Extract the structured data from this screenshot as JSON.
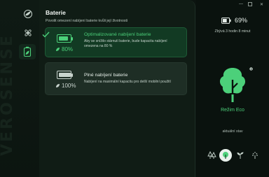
{
  "app": {
    "brand": "VEROSENSE"
  },
  "sidebar": {
    "items": [
      {
        "icon": "leaf-globe-icon",
        "label": ""
      },
      {
        "icon": "fan-icon",
        "label": ""
      },
      {
        "icon": "battery-leaf-icon",
        "label": ""
      }
    ]
  },
  "battery_settings": {
    "title": "Baterie",
    "description": "Povolit omezení nabíjení baterie kvůli její životnosti",
    "options": [
      {
        "id": "optimized",
        "title": "Optimalizované nabíjení baterie",
        "text": "Aby se snížilo stárnutí baterie, bude kapacita nabíjení omezena na 80 %",
        "percent_label": "80%",
        "fill_fraction": 0.8,
        "selected": true
      },
      {
        "id": "full",
        "title": "Plné nabíjení baterie",
        "text": "Nabíjení na maximální kapacitu pro delší mobilní použití",
        "percent_label": "100%",
        "fill_fraction": 1.0,
        "selected": false
      }
    ]
  },
  "status": {
    "battery_percent": "69%",
    "battery_fraction": 0.69,
    "remaining": "Zbývá 3 hodin 8 minut",
    "mode_name": "Režim Eco",
    "current_state_label": "aktuální stav",
    "modes": [
      {
        "icon": "trees-icon",
        "active": false
      },
      {
        "icon": "tree-icon",
        "active": true
      },
      {
        "icon": "sprout-icon",
        "active": false
      },
      {
        "icon": "sun-leaf-icon",
        "active": false
      }
    ]
  },
  "colors": {
    "accent": "#4cd07a",
    "selected_card": "#123a23",
    "card": "#1e2e25"
  }
}
